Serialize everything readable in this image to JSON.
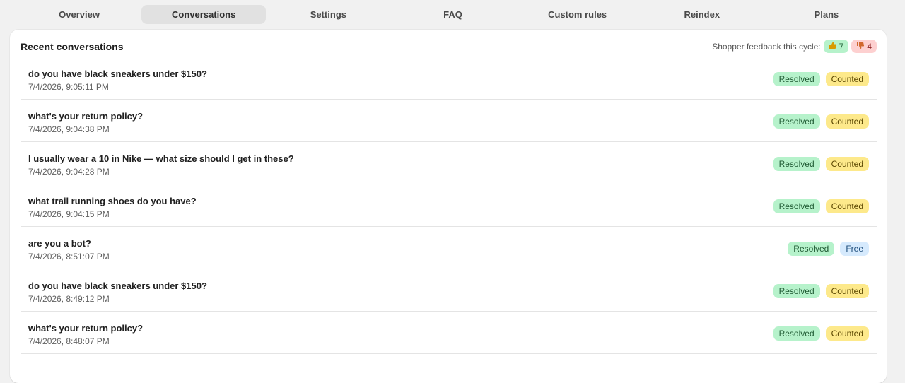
{
  "nav": {
    "tabs": [
      {
        "label": "Overview",
        "active": false
      },
      {
        "label": "Conversations",
        "active": true
      },
      {
        "label": "Settings",
        "active": false
      },
      {
        "label": "FAQ",
        "active": false
      },
      {
        "label": "Custom rules",
        "active": false
      },
      {
        "label": "Reindex",
        "active": false
      },
      {
        "label": "Plans",
        "active": false
      }
    ]
  },
  "card": {
    "title": "Recent conversations",
    "feedback": {
      "label": "Shopper feedback this cycle:",
      "up_icon": "thumbs-up-icon",
      "up_count": "7",
      "down_icon": "thumbs-down-icon",
      "down_count": "4"
    }
  },
  "conversations": [
    {
      "title": "do you have black sneakers under $150?",
      "time": "7/4/2026, 9:05:11 PM",
      "status": "Resolved",
      "billing": "Counted"
    },
    {
      "title": "what's your return policy?",
      "time": "7/4/2026, 9:04:38 PM",
      "status": "Resolved",
      "billing": "Counted"
    },
    {
      "title": "I usually wear a 10 in Nike — what size should I get in these?",
      "time": "7/4/2026, 9:04:28 PM",
      "status": "Resolved",
      "billing": "Counted"
    },
    {
      "title": "what trail running shoes do you have?",
      "time": "7/4/2026, 9:04:15 PM",
      "status": "Resolved",
      "billing": "Counted"
    },
    {
      "title": "are you a bot?",
      "time": "7/4/2026, 8:51:07 PM",
      "status": "Resolved",
      "billing": "Free"
    },
    {
      "title": "do you have black sneakers under $150?",
      "time": "7/4/2026, 8:49:12 PM",
      "status": "Resolved",
      "billing": "Counted"
    },
    {
      "title": "what's your return policy?",
      "time": "7/4/2026, 8:48:07 PM",
      "status": "Resolved",
      "billing": "Counted"
    }
  ],
  "colors": {
    "resolved_bg": "#b6f2cb",
    "counted_bg": "#fde98b",
    "free_bg": "#d6eafd",
    "thumbs_down_bg": "#fdd0d0",
    "active_tab_bg": "#e1e1e1"
  }
}
